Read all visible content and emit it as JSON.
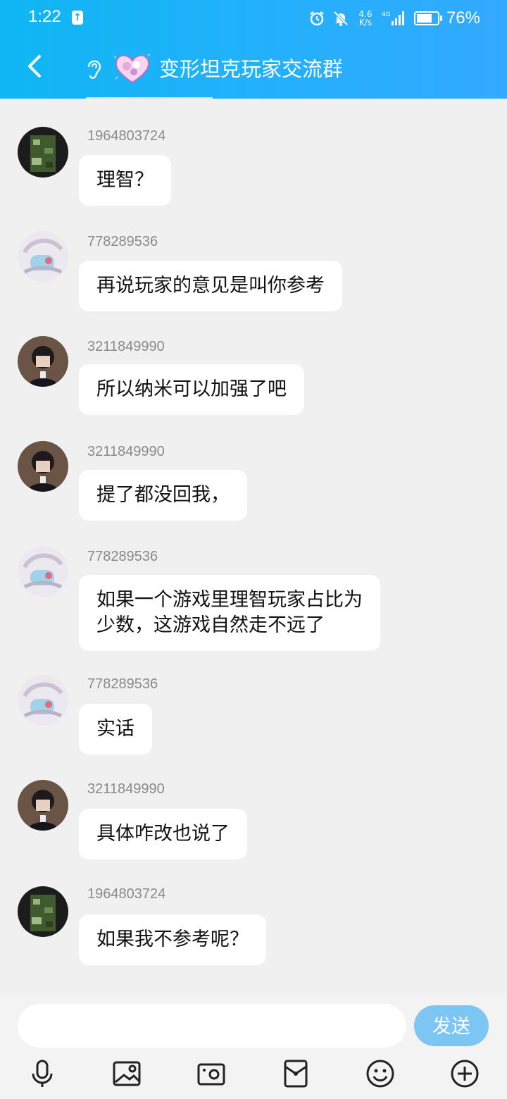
{
  "status_bar": {
    "time": "1:22",
    "speed_value": "4.6",
    "speed_unit": "K/s",
    "battery_percent": "76%",
    "battery_level": 0.76
  },
  "header": {
    "title": "变形坦克玩家交流群"
  },
  "messages": [
    {
      "sender": "1964803724",
      "text": "理智？"
    },
    {
      "sender": "778289536",
      "text": "再说玩家的意见是叫你参考"
    },
    {
      "sender": "3211849990",
      "text": "所以纳米可以加强了吧"
    },
    {
      "sender": "3211849990",
      "text": "提了都没回我，"
    },
    {
      "sender": "778289536",
      "text": "如果一个游戏里理智玩家占比为\n少数，这游戏自然走不远了"
    },
    {
      "sender": "778289536",
      "text": "实话"
    },
    {
      "sender": "3211849990",
      "text": "具体咋改也说了"
    },
    {
      "sender": "1964803724",
      "text": "如果我不参考呢？"
    }
  ],
  "composer": {
    "placeholder": "",
    "send_label": "发送"
  },
  "toolbar": [
    "mic-icon",
    "gallery-icon",
    "camera-icon",
    "red-packet-icon",
    "emoji-icon",
    "plus-icon"
  ],
  "colors": {
    "header_blue": "#1aaef5",
    "send_button": "#7dc6f3",
    "background": "#f0f0f0"
  }
}
